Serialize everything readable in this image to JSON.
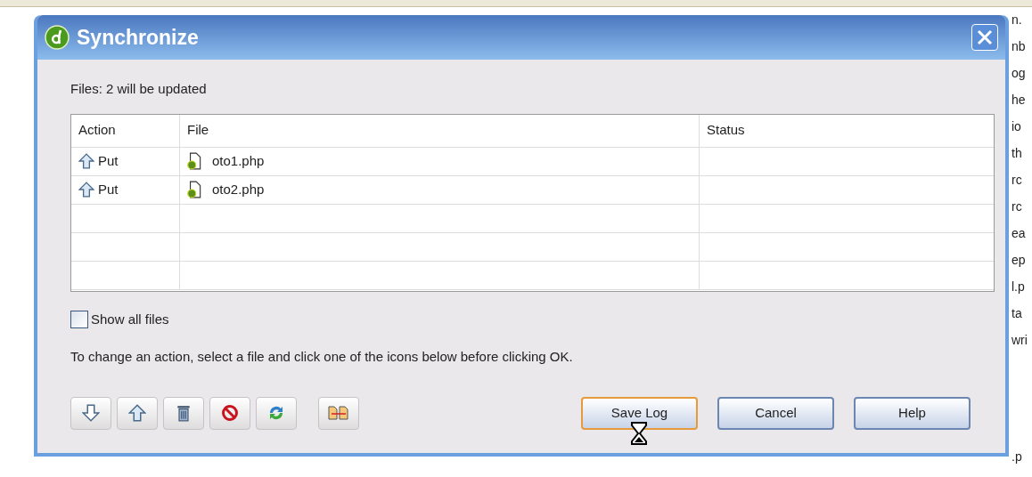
{
  "window": {
    "title": "Synchronize"
  },
  "summary": "Files: 2 will be updated",
  "table": {
    "columns": [
      "Action",
      "File",
      "Status"
    ],
    "rows": [
      {
        "action": "Put",
        "file": "oto1.php",
        "selected": false
      },
      {
        "action": "Put",
        "file": "oto2.php",
        "selected": false
      }
    ]
  },
  "show_all_files": {
    "label": "Show all files",
    "checked": false
  },
  "hint": "To change an action, select a file and click one of the icons below before clicking OK.",
  "tool_buttons": [
    {
      "kind": "down"
    },
    {
      "kind": "up"
    },
    {
      "kind": "trash"
    },
    {
      "kind": "block"
    },
    {
      "kind": "refresh"
    },
    {
      "kind": "compare"
    }
  ],
  "buttons": [
    {
      "label": "Save Log",
      "focused": true
    },
    {
      "label": "Cancel",
      "focused": false
    },
    {
      "label": "Help",
      "focused": false
    }
  ],
  "background_fragments": [
    "n.",
    "nb",
    "og",
    "he",
    "io",
    "th",
    "rc",
    "rc",
    "ea",
    "ep",
    "l.p",
    "ta",
    "wri"
  ],
  "background_bottom_fragment": ".p"
}
